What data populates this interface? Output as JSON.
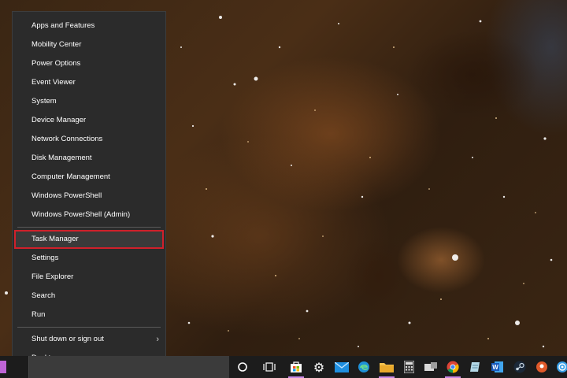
{
  "menu": {
    "items": [
      {
        "label": "Apps and Features"
      },
      {
        "label": "Mobility Center"
      },
      {
        "label": "Power Options"
      },
      {
        "label": "Event Viewer"
      },
      {
        "label": "System"
      },
      {
        "label": "Device Manager"
      },
      {
        "label": "Network Connections"
      },
      {
        "label": "Disk Management"
      },
      {
        "label": "Computer Management"
      },
      {
        "label": "Windows PowerShell"
      },
      {
        "label": "Windows PowerShell (Admin)"
      }
    ],
    "group2": [
      {
        "label": "Task Manager",
        "highlighted": true
      },
      {
        "label": "Settings"
      },
      {
        "label": "File Explorer"
      },
      {
        "label": "Search"
      },
      {
        "label": "Run"
      }
    ],
    "group3": [
      {
        "label": "Shut down or sign out",
        "has_submenu": true
      },
      {
        "label": "Desktop"
      }
    ],
    "highlight_color": "#d0202a"
  },
  "taskbar": {
    "icons": [
      {
        "name": "cortana-icon",
        "active": false
      },
      {
        "name": "task-view-icon",
        "active": false
      },
      {
        "name": "microsoft-store-icon",
        "active": true
      },
      {
        "name": "settings-gear-icon",
        "active": false
      },
      {
        "name": "mail-icon",
        "active": false
      },
      {
        "name": "edge-icon",
        "active": false
      },
      {
        "name": "file-explorer-icon",
        "active": true
      },
      {
        "name": "calculator-icon",
        "active": false
      },
      {
        "name": "devices-icon",
        "active": false
      },
      {
        "name": "chrome-icon",
        "active": true
      },
      {
        "name": "notepad-icon",
        "active": false
      },
      {
        "name": "word-icon",
        "active": false
      },
      {
        "name": "steam-icon",
        "active": false
      },
      {
        "name": "maps-pin-icon",
        "active": false
      },
      {
        "name": "swirl-app-icon",
        "active": false
      }
    ],
    "accent": "#c787e6",
    "start_accent": "#c064d6"
  }
}
